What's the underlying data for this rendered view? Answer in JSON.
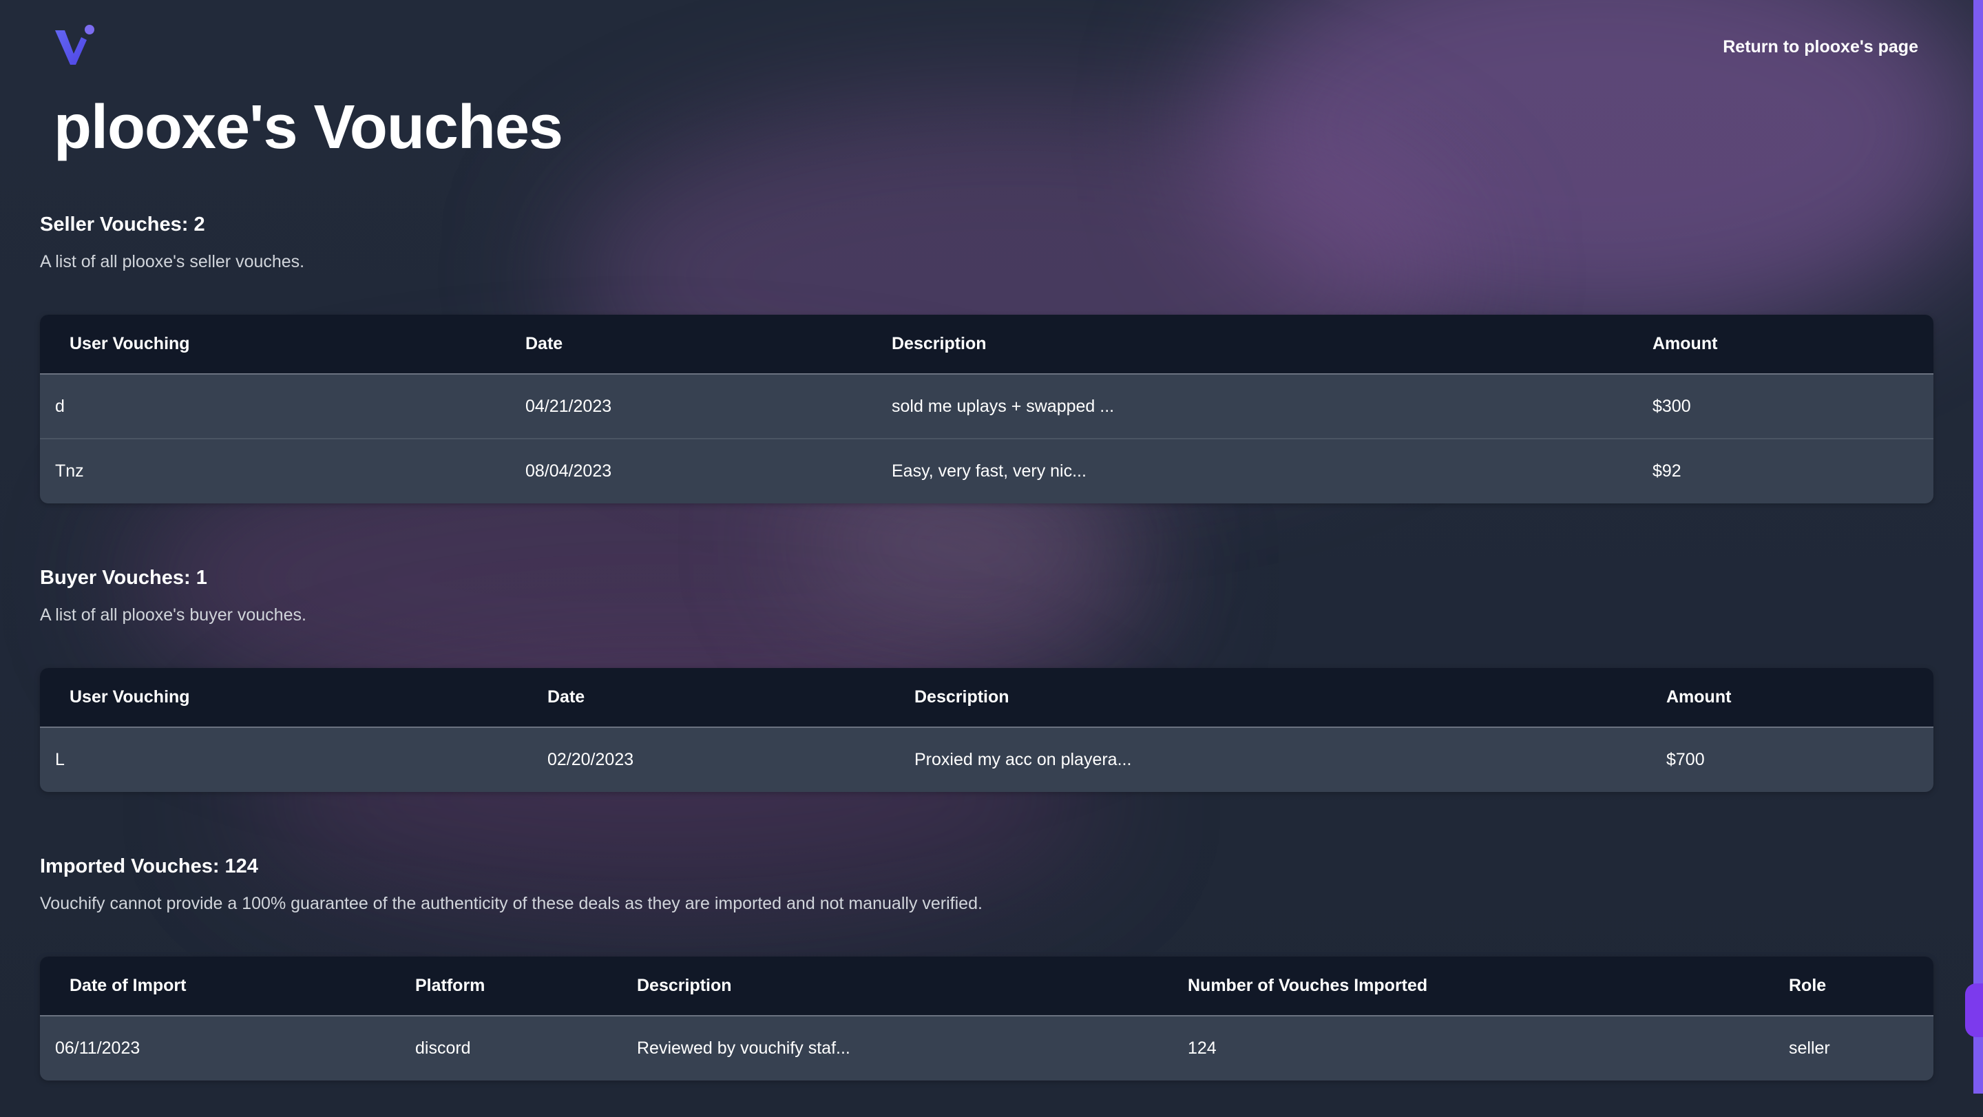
{
  "header": {
    "return_link": "Return to plooxe's page",
    "page_title": "plooxe's Vouches"
  },
  "brand": {
    "accent": "#7c5cf0",
    "logo_icon": "vouchify-logo"
  },
  "seller": {
    "title": "Seller Vouches: 2",
    "description": "A list of all plooxe's seller vouches.",
    "columns": [
      "User Vouching",
      "Date",
      "Description",
      "Amount"
    ],
    "rows": [
      [
        "d",
        "04/21/2023",
        "sold me uplays + swapped ...",
        "$300"
      ],
      [
        "Tnz",
        "08/04/2023",
        "Easy, very fast, very nic...",
        "$92"
      ]
    ]
  },
  "buyer": {
    "title": "Buyer Vouches: 1",
    "description": "A list of all plooxe's buyer vouches.",
    "columns": [
      "User Vouching",
      "Date",
      "Description",
      "Amount"
    ],
    "rows": [
      [
        "L",
        "02/20/2023",
        "Proxied my acc on playera...",
        "$700"
      ]
    ]
  },
  "imported": {
    "title": "Imported Vouches: 124",
    "description": "Vouchify cannot provide a 100% guarantee of the authenticity of these deals as they are imported and not manually verified.",
    "columns": [
      "Date of Import",
      "Platform",
      "Description",
      "Number of Vouches Imported",
      "Role"
    ],
    "rows": [
      [
        "06/11/2023",
        "discord",
        "Reviewed by vouchify staf...",
        "124",
        "seller"
      ]
    ]
  }
}
